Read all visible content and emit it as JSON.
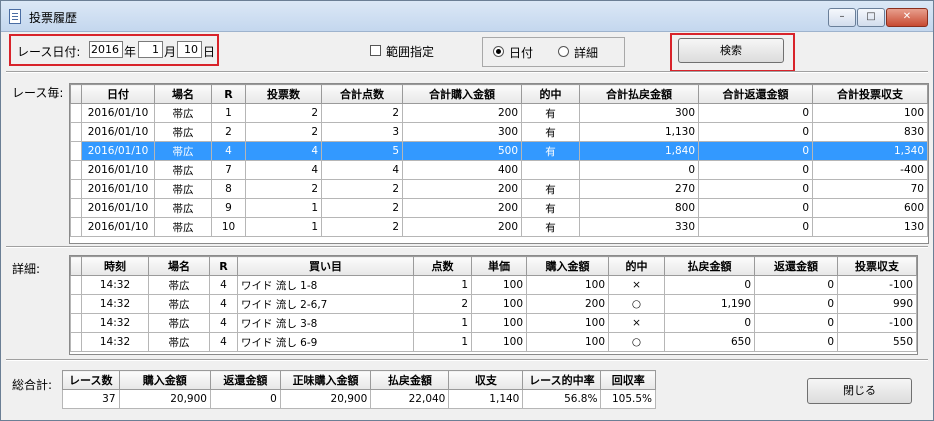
{
  "window": {
    "title": "投票履歴",
    "controls": {
      "minimize": "–",
      "maximize": "□",
      "close": "✕"
    }
  },
  "filter": {
    "race_date_label": "レース日付:",
    "year": "2016",
    "year_unit": "年",
    "month": "1",
    "month_unit": "月",
    "day": "10",
    "day_unit": "日",
    "range_label": "範囲指定",
    "radio_date": "日付",
    "radio_detail": "詳細",
    "search_button": "検索"
  },
  "race_section": {
    "label": "レース毎:",
    "columns": [
      "日付",
      "場名",
      "R",
      "投票数",
      "合計点数",
      "合計購入金額",
      "的中",
      "合計払戻金額",
      "合計返還金額",
      "合計投票収支"
    ],
    "rows": [
      [
        "2016/01/10",
        "帯広",
        "1",
        "2",
        "2",
        "200",
        "有",
        "300",
        "0",
        "100"
      ],
      [
        "2016/01/10",
        "帯広",
        "2",
        "2",
        "3",
        "300",
        "有",
        "1,130",
        "0",
        "830"
      ],
      [
        "2016/01/10",
        "帯広",
        "4",
        "4",
        "5",
        "500",
        "有",
        "1,840",
        "0",
        "1,340"
      ],
      [
        "2016/01/10",
        "帯広",
        "7",
        "4",
        "4",
        "400",
        "",
        "0",
        "0",
        "-400"
      ],
      [
        "2016/01/10",
        "帯広",
        "8",
        "2",
        "2",
        "200",
        "有",
        "270",
        "0",
        "70"
      ],
      [
        "2016/01/10",
        "帯広",
        "9",
        "1",
        "2",
        "200",
        "有",
        "800",
        "0",
        "600"
      ],
      [
        "2016/01/10",
        "帯広",
        "10",
        "1",
        "2",
        "200",
        "有",
        "330",
        "0",
        "130"
      ]
    ],
    "selected_row": 2
  },
  "detail_section": {
    "label": "詳細:",
    "columns": [
      "時刻",
      "場名",
      "R",
      "買い目",
      "点数",
      "単価",
      "購入金額",
      "的中",
      "払戻金額",
      "返還金額",
      "投票収支"
    ],
    "rows": [
      [
        "14:32",
        "帯広",
        "4",
        "ワイド 流し 1-8",
        "1",
        "100",
        "100",
        "×",
        "0",
        "0",
        "-100"
      ],
      [
        "14:32",
        "帯広",
        "4",
        "ワイド 流し 2-6,7",
        "2",
        "100",
        "200",
        "○",
        "1,190",
        "0",
        "990"
      ],
      [
        "14:32",
        "帯広",
        "4",
        "ワイド 流し 3-8",
        "1",
        "100",
        "100",
        "×",
        "0",
        "0",
        "-100"
      ],
      [
        "14:32",
        "帯広",
        "4",
        "ワイド 流し 6-9",
        "1",
        "100",
        "100",
        "○",
        "650",
        "0",
        "550"
      ]
    ]
  },
  "total_section": {
    "label": "総合計:",
    "columns": [
      "レース数",
      "購入金額",
      "返還金額",
      "正味購入金額",
      "払戻金額",
      "収支",
      "レース的中率",
      "回収率"
    ],
    "values": [
      "37",
      "20,900",
      "0",
      "20,900",
      "22,040",
      "1,140",
      "56.8%",
      "105.5%"
    ],
    "close_button": "閉じる"
  },
  "colors": {
    "highlight": "#3399ff",
    "annotation_red": "#d8232a"
  }
}
